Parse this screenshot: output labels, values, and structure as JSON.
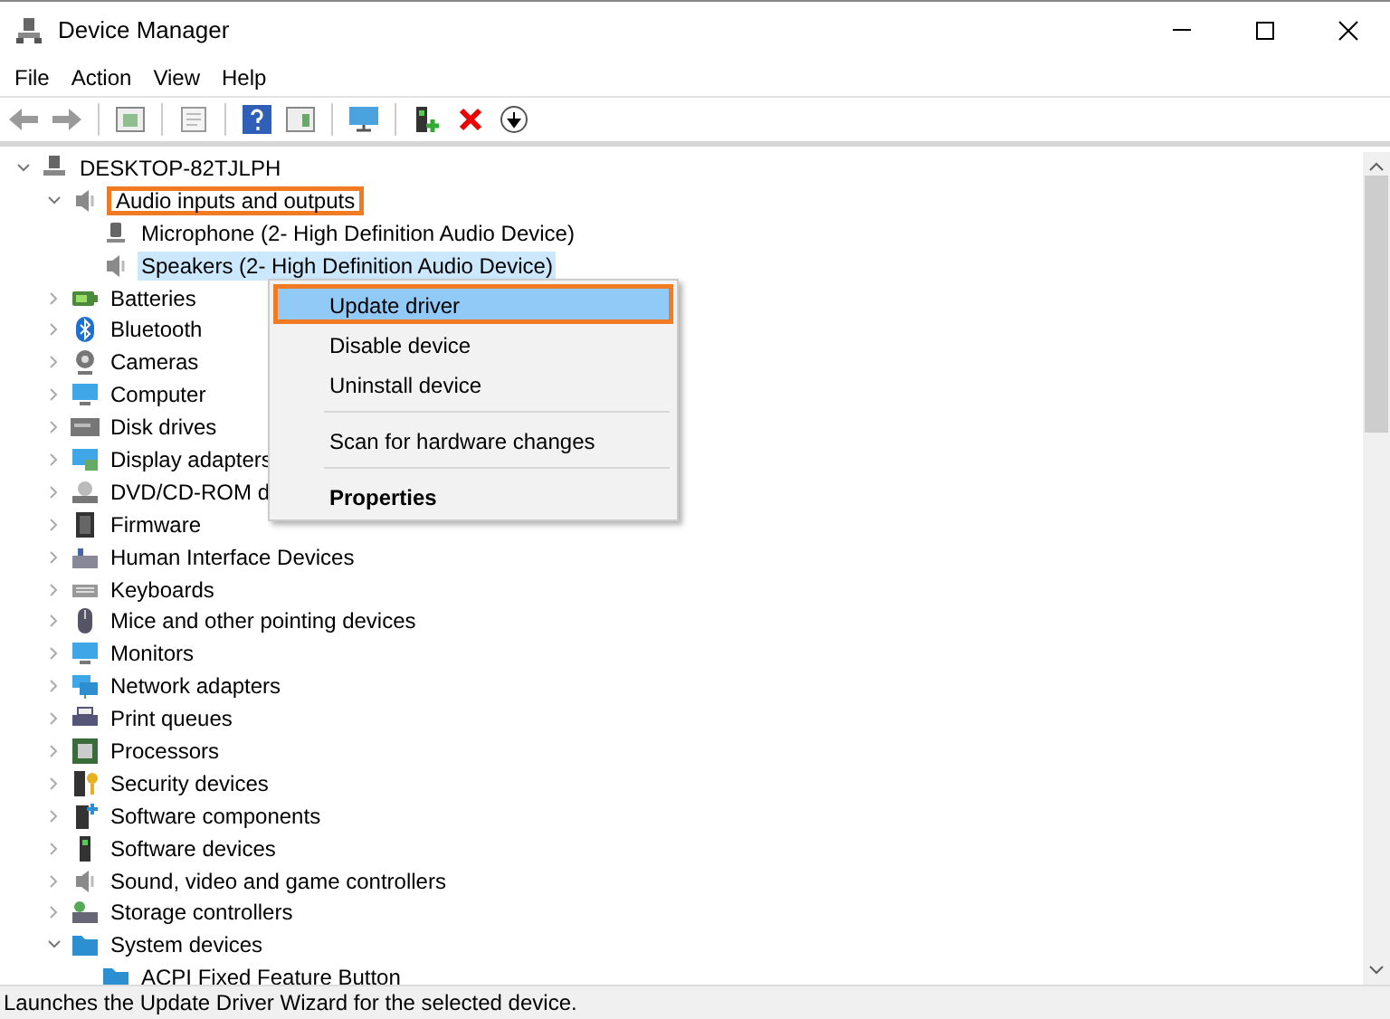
{
  "window": {
    "title": "Device Manager"
  },
  "menu_bar": [
    "File",
    "Action",
    "View",
    "Help"
  ],
  "tree": [
    {
      "label": "DESKTOP-82TJLPH",
      "expanded": true,
      "selected": false,
      "highlighted": false,
      "children": [
        {
          "label": "Audio inputs and outputs",
          "expanded": true,
          "selected": false,
          "highlighted": true,
          "children": [
            {
              "label": "Microphone (2- High Definition Audio Device)",
              "selected": false,
              "highlighted": false
            },
            {
              "label": "Speakers (2- High Definition Audio Device)",
              "selected": true,
              "highlighted": false
            }
          ]
        },
        {
          "label": "Batteries",
          "expanded": false,
          "selected": false,
          "highlighted": false
        },
        {
          "label": "Bluetooth",
          "expanded": false,
          "selected": false,
          "highlighted": false
        },
        {
          "label": "Cameras",
          "expanded": false,
          "selected": false,
          "highlighted": false
        },
        {
          "label": "Computer",
          "expanded": false,
          "selected": false,
          "highlighted": false
        },
        {
          "label": "Disk drives",
          "expanded": false,
          "selected": false,
          "highlighted": false
        },
        {
          "label": "Display adapters",
          "expanded": false,
          "selected": false,
          "highlighted": false
        },
        {
          "label": "DVD/CD-ROM d",
          "expanded": false,
          "selected": false,
          "highlighted": false
        },
        {
          "label": "Firmware",
          "expanded": false,
          "selected": false,
          "highlighted": false
        },
        {
          "label": "Human Interface Devices",
          "expanded": false,
          "selected": false,
          "highlighted": false
        },
        {
          "label": "Keyboards",
          "expanded": false,
          "selected": false,
          "highlighted": false
        },
        {
          "label": "Mice and other pointing devices",
          "expanded": false,
          "selected": false,
          "highlighted": false
        },
        {
          "label": "Monitors",
          "expanded": false,
          "selected": false,
          "highlighted": false
        },
        {
          "label": "Network adapters",
          "expanded": false,
          "selected": false,
          "highlighted": false
        },
        {
          "label": "Print queues",
          "expanded": false,
          "selected": false,
          "highlighted": false
        },
        {
          "label": "Processors",
          "expanded": false,
          "selected": false,
          "highlighted": false
        },
        {
          "label": "Security devices",
          "expanded": false,
          "selected": false,
          "highlighted": false
        },
        {
          "label": "Software components",
          "expanded": false,
          "selected": false,
          "highlighted": false
        },
        {
          "label": "Software devices",
          "expanded": false,
          "selected": false,
          "highlighted": false
        },
        {
          "label": "Sound, video and game controllers",
          "expanded": false,
          "selected": false,
          "highlighted": false
        },
        {
          "label": "Storage controllers",
          "expanded": false,
          "selected": false,
          "highlighted": false
        },
        {
          "label": "System devices",
          "expanded": true,
          "selected": false,
          "highlighted": false,
          "children": [
            {
              "label": "ACPI Fixed Feature Button",
              "selected": false,
              "highlighted": false
            }
          ]
        }
      ]
    }
  ],
  "context_menu": [
    {
      "kind": "item",
      "label": "Update driver",
      "selected": true,
      "highlighted": true
    },
    {
      "kind": "item",
      "label": "Disable device",
      "selected": false,
      "highlighted": false
    },
    {
      "kind": "item",
      "label": "Uninstall device",
      "selected": false,
      "highlighted": false
    },
    {
      "kind": "separator"
    },
    {
      "kind": "item",
      "label": "Scan for hardware changes",
      "selected": false,
      "highlighted": false
    },
    {
      "kind": "separator"
    },
    {
      "kind": "default",
      "label": "Properties",
      "selected": false,
      "highlighted": false
    }
  ],
  "status_bar": "Launches the Update Driver Wizard for the selected device."
}
